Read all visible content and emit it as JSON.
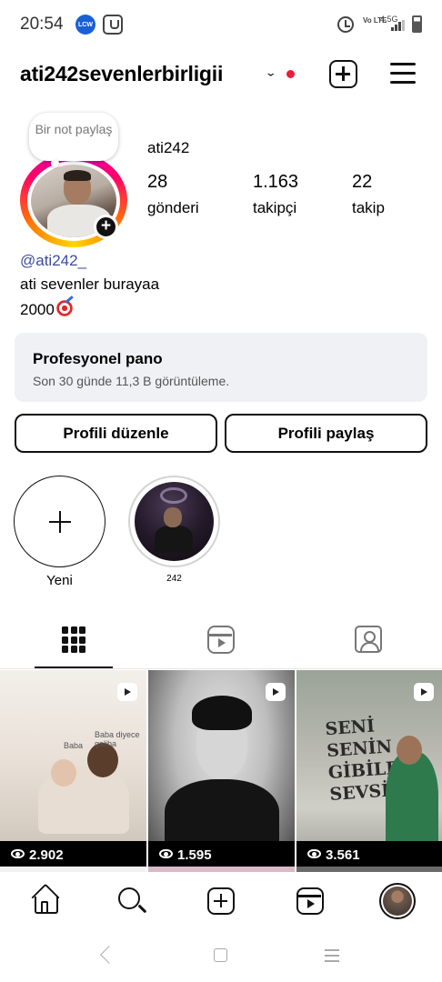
{
  "status_bar": {
    "time": "20:54",
    "notification_badge": "LCW",
    "network": "4.5G",
    "volte": "Vo LTE"
  },
  "header": {
    "username": "ati242sevenlerbirligii",
    "chevron": "⌄"
  },
  "profile": {
    "note_text": "Bir not paylaş",
    "display_name": "ati242",
    "stats": [
      {
        "value": "28",
        "label": "gönderi"
      },
      {
        "value": "1.163",
        "label": "takipçi"
      },
      {
        "value": "22",
        "label": "takip"
      }
    ],
    "handle": "@ati242_",
    "bio_line_1": "ati sevenler burayaa",
    "bio_line_2": "2000"
  },
  "dashboard": {
    "title": "Profesyonel pano",
    "subtitle": "Son 30 günde 11,3 B görüntüleme."
  },
  "actions": {
    "edit_profile": "Profili düzenle",
    "share_profile": "Profili paylaş"
  },
  "highlights": [
    {
      "label": "Yeni"
    },
    {
      "label": "242"
    }
  ],
  "tabs": [
    {
      "icon": "grid-icon"
    },
    {
      "icon": "reels-icon"
    },
    {
      "icon": "tagged-icon"
    }
  ],
  "posts": [
    {
      "views": "2.902",
      "caption_1": "Baba diyece galiba",
      "caption_2": "Baba"
    },
    {
      "views": "1.595"
    },
    {
      "views": "3.561",
      "wall_text": "SENİ SENİN GİBİLER SEVSİN"
    }
  ],
  "colors": {
    "notification_dot": "#ef1a3a",
    "handle": "#3d4ba3",
    "dashboard_bg": "#eff1f4"
  }
}
